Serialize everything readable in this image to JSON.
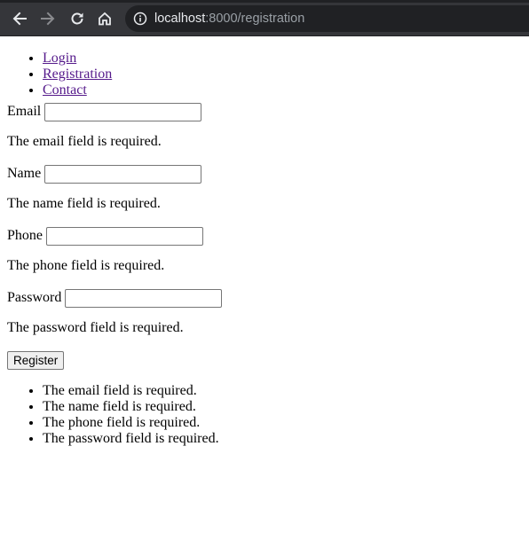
{
  "browser": {
    "url_host": "localhost",
    "url_rest": ":8000/registration",
    "back_icon": "arrow-left-icon",
    "forward_icon": "arrow-right-icon",
    "reload_icon": "reload-icon",
    "home_icon": "home-icon",
    "info_icon": "info-icon"
  },
  "nav": {
    "items": [
      {
        "label": "Login"
      },
      {
        "label": "Registration"
      },
      {
        "label": "Contact"
      }
    ]
  },
  "form": {
    "email": {
      "label": "Email",
      "value": "",
      "error": "The email field is required."
    },
    "name": {
      "label": "Name",
      "value": "",
      "error": "The name field is required."
    },
    "phone": {
      "label": "Phone",
      "value": "",
      "error": "The phone field is required."
    },
    "password": {
      "label": "Password",
      "value": "",
      "error": "The password field is required."
    },
    "submit_label": "Register"
  },
  "error_summary": [
    "The email field is required.",
    "The name field is required.",
    "The phone field is required.",
    "The password field is required."
  ]
}
